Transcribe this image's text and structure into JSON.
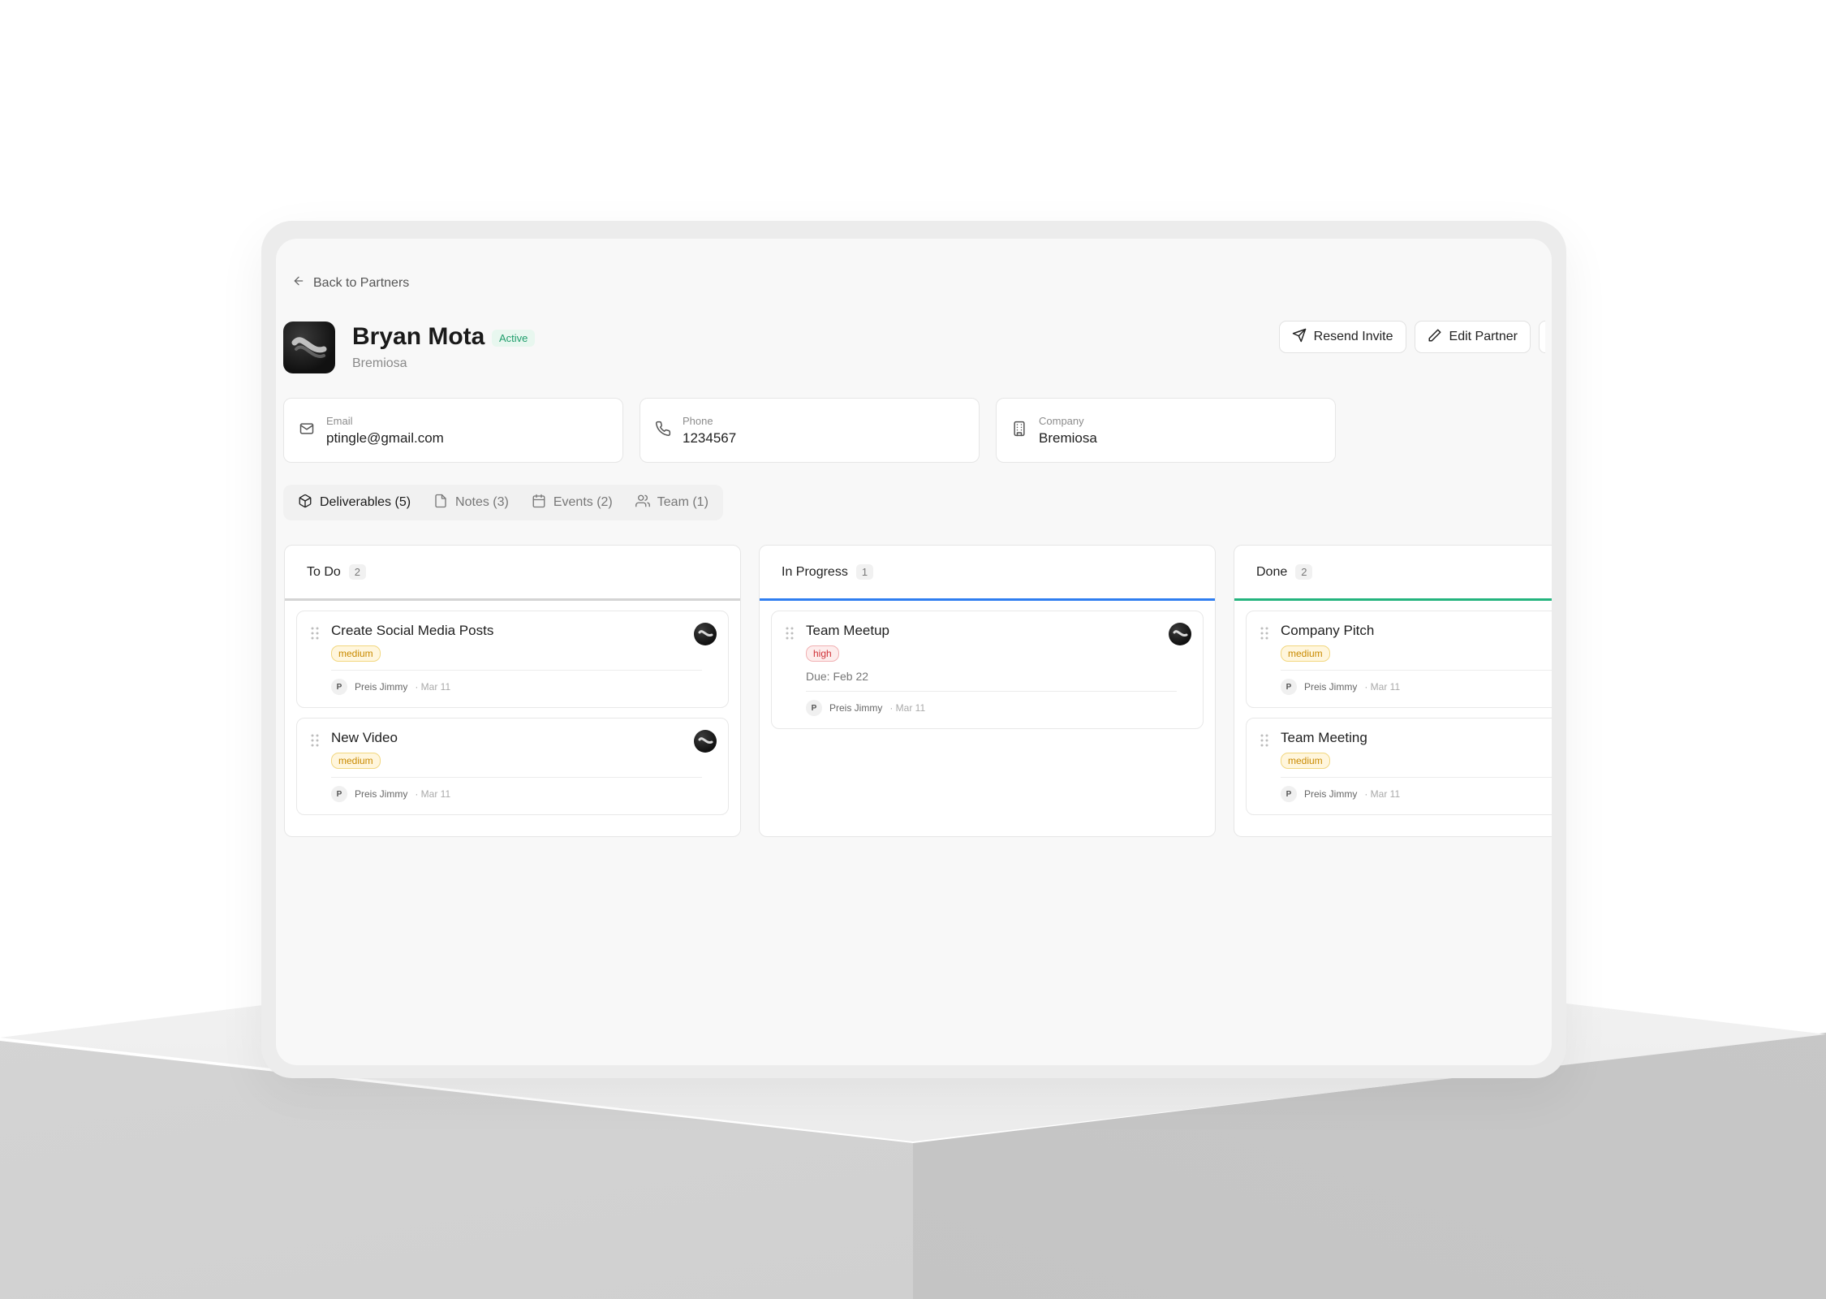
{
  "header": {
    "back_label": "Back to Partners",
    "partner_name": "Bryan Mota",
    "status": "Active",
    "company": "Bremiosa",
    "actions": {
      "resend_label": "Resend Invite",
      "edit_label": "Edit Partner"
    }
  },
  "info": {
    "email": {
      "label": "Email",
      "value": "ptingle@gmail.com"
    },
    "phone": {
      "label": "Phone",
      "value": "1234567"
    },
    "company": {
      "label": "Company",
      "value": "Bremiosa"
    }
  },
  "tabs": [
    {
      "label": "Deliverables (5)",
      "icon": "package-icon",
      "active": true
    },
    {
      "label": "Notes (3)",
      "icon": "file-icon",
      "active": false
    },
    {
      "label": "Events (2)",
      "icon": "calendar-icon",
      "active": false
    },
    {
      "label": "Team (1)",
      "icon": "users-icon",
      "active": false
    }
  ],
  "columns": [
    {
      "title": "To Do",
      "count": "2",
      "accent": "#d4d4d4",
      "cards": [
        {
          "title": "Create Social Media Posts",
          "priority": "medium",
          "author_initial": "P",
          "author": "Preis Jimmy",
          "date": "· Mar 11"
        },
        {
          "title": "New Video",
          "priority": "medium",
          "author_initial": "P",
          "author": "Preis Jimmy",
          "date": "· Mar 11"
        }
      ]
    },
    {
      "title": "In Progress",
      "count": "1",
      "accent": "#2f7ef0",
      "cards": [
        {
          "title": "Team Meetup",
          "priority": "high",
          "due": "Due: Feb 22",
          "author_initial": "P",
          "author": "Preis Jimmy",
          "date": "· Mar 11"
        }
      ]
    },
    {
      "title": "Done",
      "count": "2",
      "accent": "#24b47e",
      "cards": [
        {
          "title": "Company Pitch",
          "priority": "medium",
          "author_initial": "P",
          "author": "Preis Jimmy",
          "date": "· Mar 11"
        },
        {
          "title": "Team Meeting",
          "priority": "medium",
          "author_initial": "P",
          "author": "Preis Jimmy",
          "date": "· Mar 11"
        }
      ]
    }
  ],
  "colors": {
    "active_status": "#1f9d6b",
    "medium": "#c98a00",
    "high": "#d0343a",
    "in_progress": "#2f7ef0",
    "done": "#24b47e"
  }
}
